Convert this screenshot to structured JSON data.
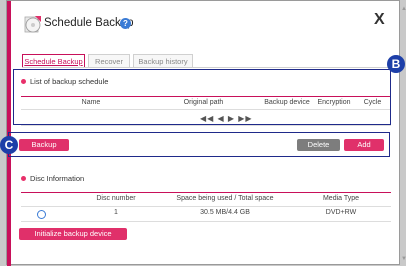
{
  "dialog": {
    "title": "Schedule Backup",
    "help_glyph": "?",
    "close_glyph": "X"
  },
  "tabs": [
    {
      "label": "Schedule Backup",
      "active": true
    },
    {
      "label": "Recover",
      "active": false
    },
    {
      "label": "Backup history",
      "active": false
    }
  ],
  "schedule_list": {
    "title": "List of backup schedule",
    "columns": [
      "Name",
      "Original path",
      "Backup device",
      "Encryption",
      "Cycle"
    ],
    "pager": "◀◀ ◀ ▶ ▶▶"
  },
  "actions": {
    "backup_label": "Backup",
    "delete_label": "Delete",
    "add_label": "Add"
  },
  "disc_info": {
    "title": "Disc Information",
    "columns": [
      "Disc number",
      "Space being used / Total space",
      "Media Type"
    ],
    "rows": [
      {
        "disc_number": "1",
        "space": "30.5 MB/4.4 GB",
        "media_type": "DVD+RW"
      }
    ],
    "init_button": "Initialize backup device"
  },
  "annotations": {
    "b_label": "B",
    "c_label": "C",
    "color": "#1d3fa8"
  },
  "colors": {
    "accent": "#e0306a",
    "button_gray": "#7d7d7d"
  },
  "icons": {
    "title_icon": "backup-disc-icon",
    "help_icon": "help-icon",
    "close_icon": "close-icon"
  }
}
